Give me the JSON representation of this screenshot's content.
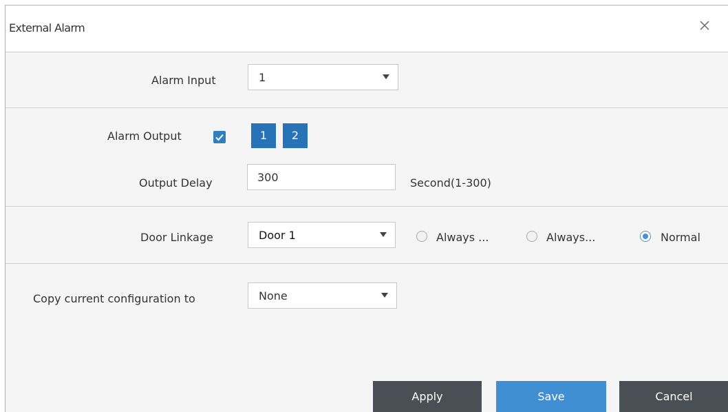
{
  "dialog": {
    "title": "External Alarm",
    "close_icon": "close-icon"
  },
  "alarm_input": {
    "label": "Alarm Input",
    "value": "1"
  },
  "alarm_output": {
    "label": "Alarm Output",
    "enabled": true,
    "outputs": [
      "1",
      "2"
    ]
  },
  "output_delay": {
    "label": "Output Delay",
    "value": "300",
    "hint": "Second(1-300)"
  },
  "door_linkage": {
    "label": "Door Linkage",
    "value": "Door 1",
    "options": [
      {
        "label": "Always ...",
        "checked": false
      },
      {
        "label": "Always...",
        "checked": false
      },
      {
        "label": "Normal",
        "checked": true
      }
    ]
  },
  "copy_config": {
    "label": "Copy current configuration to",
    "value": "None"
  },
  "buttons": {
    "apply": "Apply",
    "save": "Save",
    "cancel": "Cancel"
  },
  "colors": {
    "accent": "#2872b8",
    "dark_button": "#4a4f56",
    "blue_button": "#3f8fd2"
  }
}
